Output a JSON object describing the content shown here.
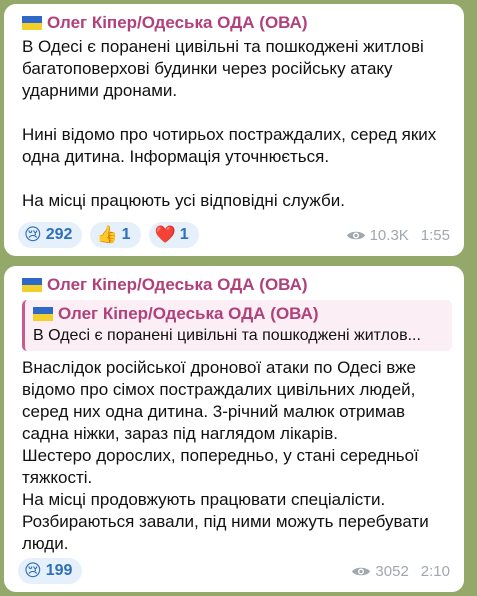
{
  "messages": [
    {
      "sender": "Олег Кіпер/Одеська ОДА (ОВА)",
      "text": "В Одесі є поранені цивільні та пошкоджені житлові багатоповерхові будинки через російську атаку ударними дронами.\n\nНині відомо про чотирьох постраждалих, серед яких одна дитина. Інформація уточнюється.\n\nНа місці працюють усі відповідні служби.",
      "reactions": [
        {
          "emoji": "😢",
          "icon": "crying-face-icon",
          "count": "292"
        },
        {
          "emoji": "👍",
          "icon": "thumbs-up-icon",
          "count": "1"
        },
        {
          "emoji": "❤️",
          "icon": "heart-icon",
          "count": "1"
        }
      ],
      "views": "10.3K",
      "time": "1:55"
    },
    {
      "sender": "Олег Кіпер/Одеська ОДА (ОВА)",
      "reply": {
        "sender": "Олег Кіпер/Одеська ОДА (ОВА)",
        "text": "В Одесі є поранені цивільні та пошкоджені житлов..."
      },
      "text": "Внаслідок російської дронової атаки по Одесі вже відомо про сімох постраждалих цивільних людей, серед них одна дитина. 3-річний малюк отримав садна ніжки, зараз під наглядом лікарів.\nШестеро дорослих, попередньо, у стані середньої тяжкості.\nНа місці продовжують працювати спеціалісти. Розбираються завали, під ними можуть перебувати люди.",
      "reactions": [
        {
          "emoji": "😢",
          "icon": "crying-face-icon",
          "count": "199"
        }
      ],
      "views": "3052",
      "time": "2:10"
    }
  ],
  "colors": {
    "background": "#94a86a",
    "sender": "#b0417c",
    "reaction_text": "#2d6fb8",
    "meta": "#a0a7ae"
  }
}
